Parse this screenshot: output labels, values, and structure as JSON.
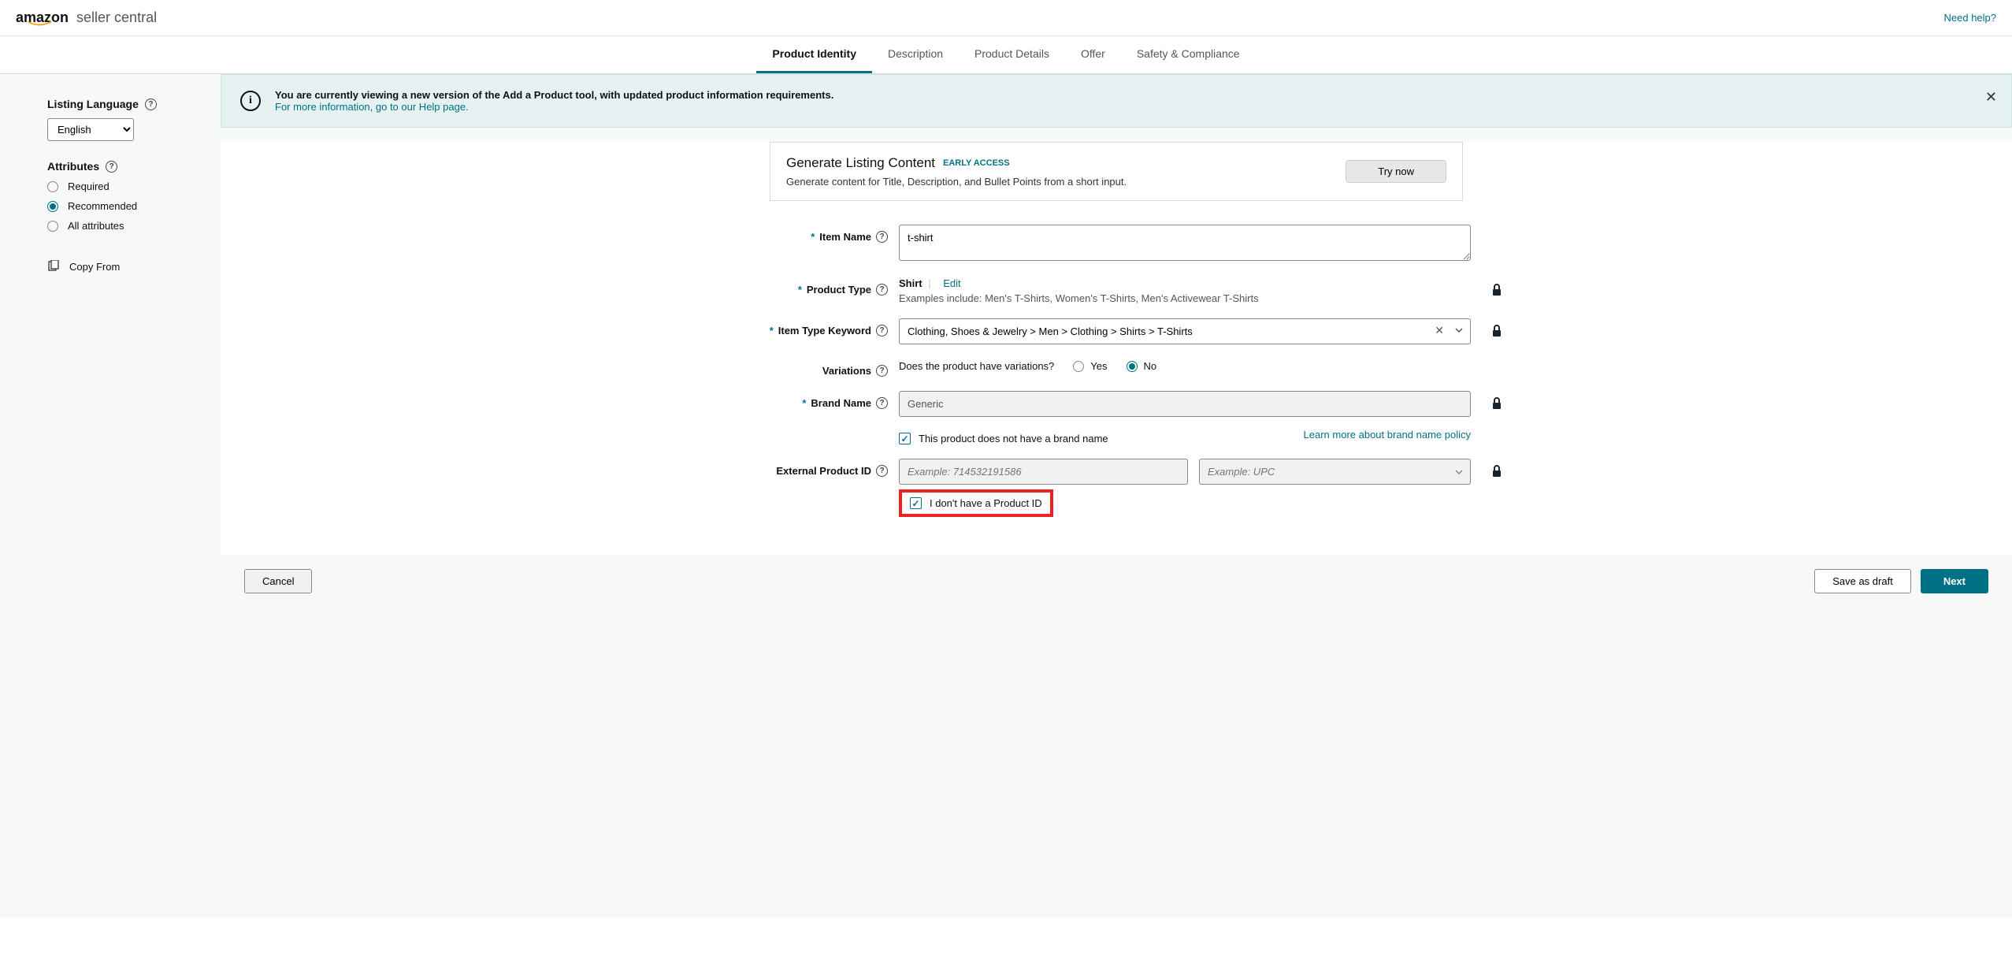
{
  "header": {
    "logo_main": "amazon",
    "logo_sub": "seller central",
    "need_help": "Need help?"
  },
  "nav": {
    "tabs": [
      "Product Identity",
      "Description",
      "Product Details",
      "Offer",
      "Safety & Compliance"
    ],
    "active_index": 0
  },
  "sidebar": {
    "lang_title": "Listing Language",
    "lang_value": "English",
    "attr_title": "Attributes",
    "attr_options": [
      "Required",
      "Recommended",
      "All attributes"
    ],
    "attr_selected_index": 1,
    "copy_from": "Copy From"
  },
  "banner": {
    "line1": "You are currently viewing a new version of the Add a Product tool, with updated product information requirements.",
    "line2": "For more information, go to our Help page."
  },
  "gen": {
    "title": "Generate Listing Content",
    "badge": "EARLY ACCESS",
    "desc": "Generate content for Title, Description, and Bullet Points from a short input.",
    "button": "Try now"
  },
  "form": {
    "item_name": {
      "label": "Item Name",
      "value": "t-shirt"
    },
    "product_type": {
      "label": "Product Type",
      "value": "Shirt",
      "edit": "Edit",
      "examples": "Examples include: Men's T-Shirts, Women's T-Shirts, Men's Activewear T-Shirts"
    },
    "item_type_keyword": {
      "label": "Item Type Keyword",
      "value": "Clothing, Shoes & Jewelry > Men > Clothing > Shirts > T-Shirts"
    },
    "variations": {
      "label": "Variations",
      "question": "Does the product have variations?",
      "yes": "Yes",
      "no": "No",
      "selected": "no"
    },
    "brand": {
      "label": "Brand Name",
      "value": "Generic",
      "no_brand_check": "This product does not have a brand name",
      "policy_link": "Learn more about brand name policy"
    },
    "ext_id": {
      "label": "External Product ID",
      "placeholder_id": "Example: 714532191586",
      "placeholder_type": "Example: UPC",
      "no_id_check": "I don't have a Product ID"
    }
  },
  "footer": {
    "cancel": "Cancel",
    "draft": "Save as draft",
    "next": "Next"
  }
}
